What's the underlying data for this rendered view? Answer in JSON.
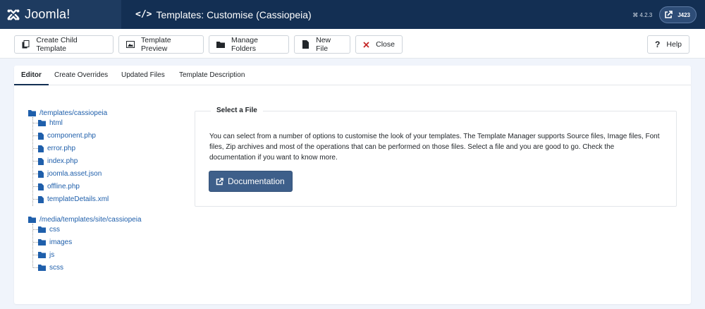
{
  "header": {
    "logo_text": "Joomla!",
    "title": "Templates: Customise (Cassiopeia)",
    "version": "⌘ 4.2.3",
    "user_label": "J423"
  },
  "toolbar": {
    "create_child": "Create Child Template",
    "preview": "Template Preview",
    "manage_folders": "Manage Folders",
    "new_file": "New File",
    "close": "Close",
    "help": "Help"
  },
  "tabs": [
    "Editor",
    "Create Overrides",
    "Updated Files",
    "Template Description"
  ],
  "tree": {
    "root1": "/templates/cassiopeia",
    "root1_children": [
      "html",
      "component.php",
      "error.php",
      "index.php",
      "joomla.asset.json",
      "offline.php",
      "templateDetails.xml"
    ],
    "root2": "/media/templates/site/cassiopeia",
    "root2_children": [
      "css",
      "images",
      "js",
      "scss"
    ]
  },
  "select_file": {
    "legend": "Select a File",
    "description": "You can select from a number of options to customise the look of your templates. The Template Manager supports Source files, Image files, Font files, Zip archives and most of the operations that can be performed on those files. Select a file and you are good to go. Check the documentation if you want to know more.",
    "button": "Documentation"
  },
  "colors": {
    "header_bg": "#132f53",
    "link": "#1f5fab",
    "primary_button": "#3e5f8a",
    "close_icon": "#c52827"
  }
}
